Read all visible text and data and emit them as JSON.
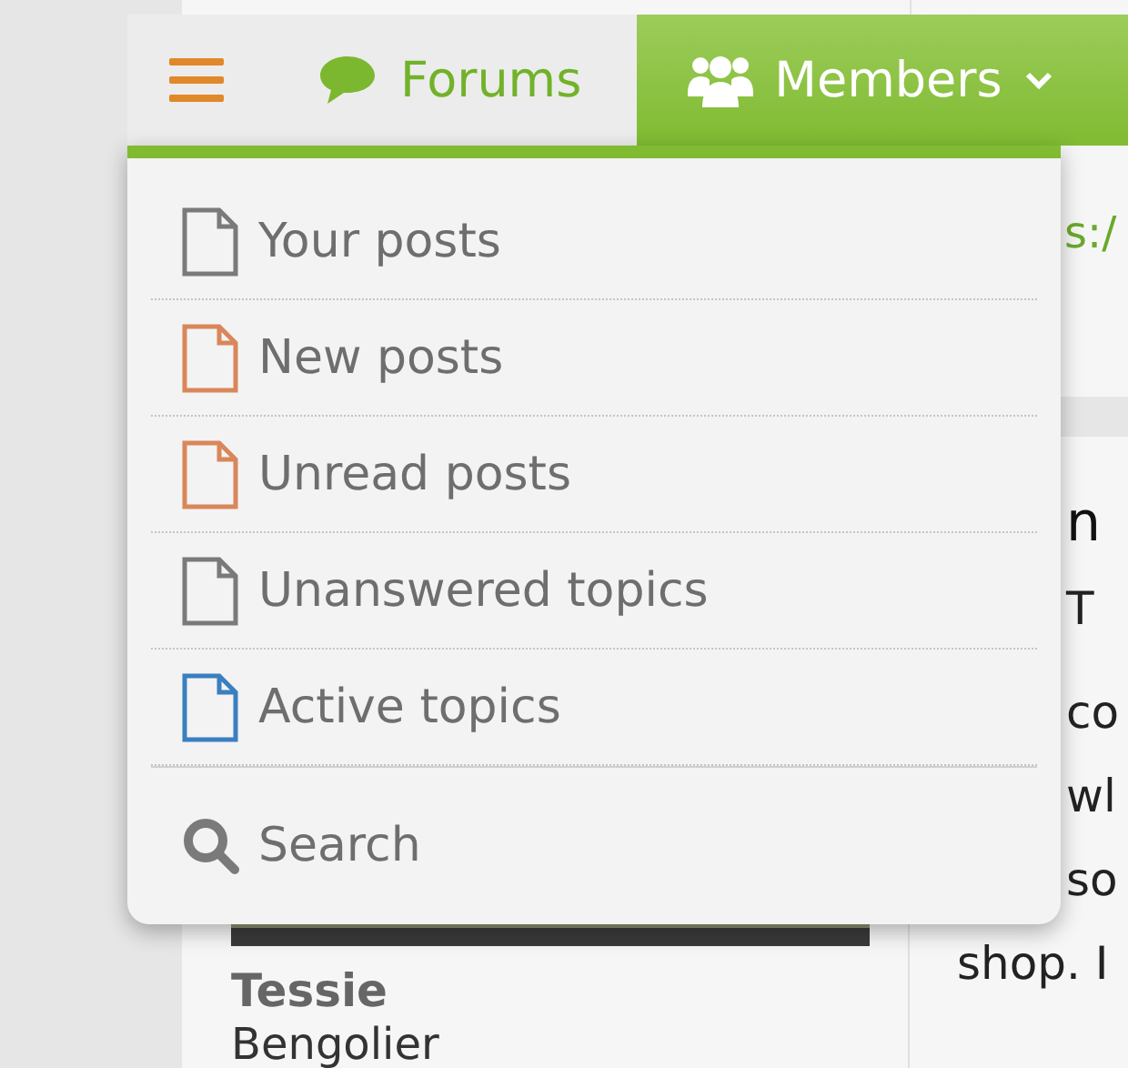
{
  "link_text": "s:/",
  "post": {
    "title": "n",
    "byline": "T",
    "body_lines": [
      {
        "text": "co",
        "kind": "tail"
      },
      {
        "text": "wl",
        "kind": "tail"
      },
      {
        "text": "so",
        "kind": "tail"
      },
      {
        "text": "shop. I",
        "kind": "full"
      }
    ]
  },
  "author": {
    "name": "Tessie",
    "rank": "Bengolier"
  },
  "navbar": {
    "tabs": [
      {
        "label": "Forums",
        "selected": false
      },
      {
        "label": "Members",
        "selected": true
      }
    ]
  },
  "menu": {
    "items": [
      {
        "label": "Your posts",
        "color": "#7a7a7a"
      },
      {
        "label": "New posts",
        "color": "#d9875a"
      },
      {
        "label": "Unread posts",
        "color": "#d9875a"
      },
      {
        "label": "Unanswered topics",
        "color": "#7a7a7a"
      },
      {
        "label": "Active topics",
        "color": "#3a7fbf"
      }
    ],
    "search": "Search"
  }
}
